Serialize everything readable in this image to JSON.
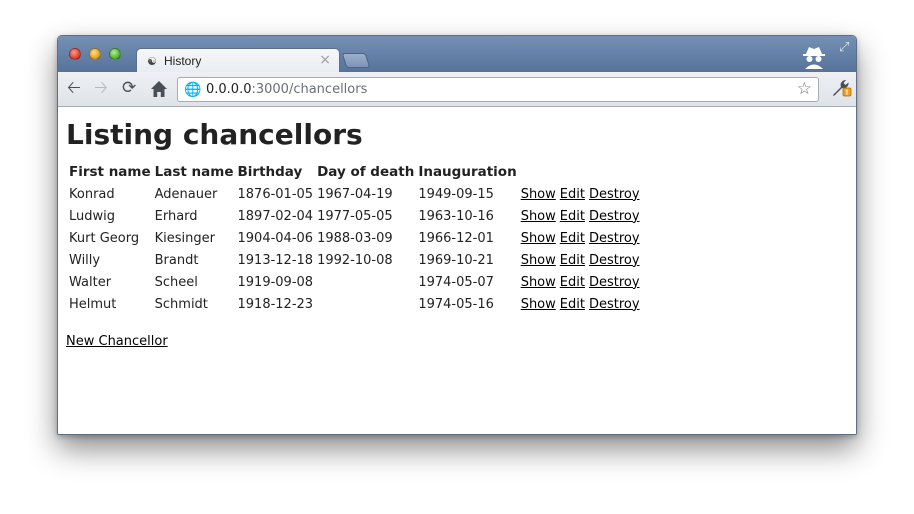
{
  "browser": {
    "tab_title": "History",
    "tab_close": "×",
    "url_host": "0.0.0.0",
    "url_rest": ":3000/chancellors",
    "icons": {
      "tab": "incognito-tab-icon",
      "back": "back-arrow-icon",
      "forward": "forward-arrow-icon",
      "reload": "reload-icon",
      "home": "home-icon",
      "page": "globe-icon",
      "bookmark": "star-icon",
      "settings": "wrench-icon",
      "incognito": "incognito-icon",
      "fullscreen": "expand-icon"
    }
  },
  "page": {
    "title": "Listing chancellors",
    "columns": [
      "First name",
      "Last name",
      "Birthday",
      "Day of death",
      "Inauguration"
    ],
    "rows": [
      {
        "first": "Konrad",
        "last": "Adenauer",
        "birthday": "1876-01-05",
        "death": "1967-04-19",
        "inauguration": "1949-09-15"
      },
      {
        "first": "Ludwig",
        "last": "Erhard",
        "birthday": "1897-02-04",
        "death": "1977-05-05",
        "inauguration": "1963-10-16"
      },
      {
        "first": "Kurt Georg",
        "last": "Kiesinger",
        "birthday": "1904-04-06",
        "death": "1988-03-09",
        "inauguration": "1966-12-01"
      },
      {
        "first": "Willy",
        "last": "Brandt",
        "birthday": "1913-12-18",
        "death": "1992-10-08",
        "inauguration": "1969-10-21"
      },
      {
        "first": "Walter",
        "last": "Scheel",
        "birthday": "1919-09-08",
        "death": "",
        "inauguration": "1974-05-07"
      },
      {
        "first": "Helmut",
        "last": "Schmidt",
        "birthday": "1918-12-23",
        "death": "",
        "inauguration": "1974-05-16"
      }
    ],
    "actions": {
      "show": "Show",
      "edit": "Edit",
      "destroy": "Destroy"
    },
    "new_link": "New Chancellor"
  },
  "colors": {
    "titlebar": "#6783a8",
    "toolbar": "#e5e8ec",
    "text": "#222222"
  }
}
